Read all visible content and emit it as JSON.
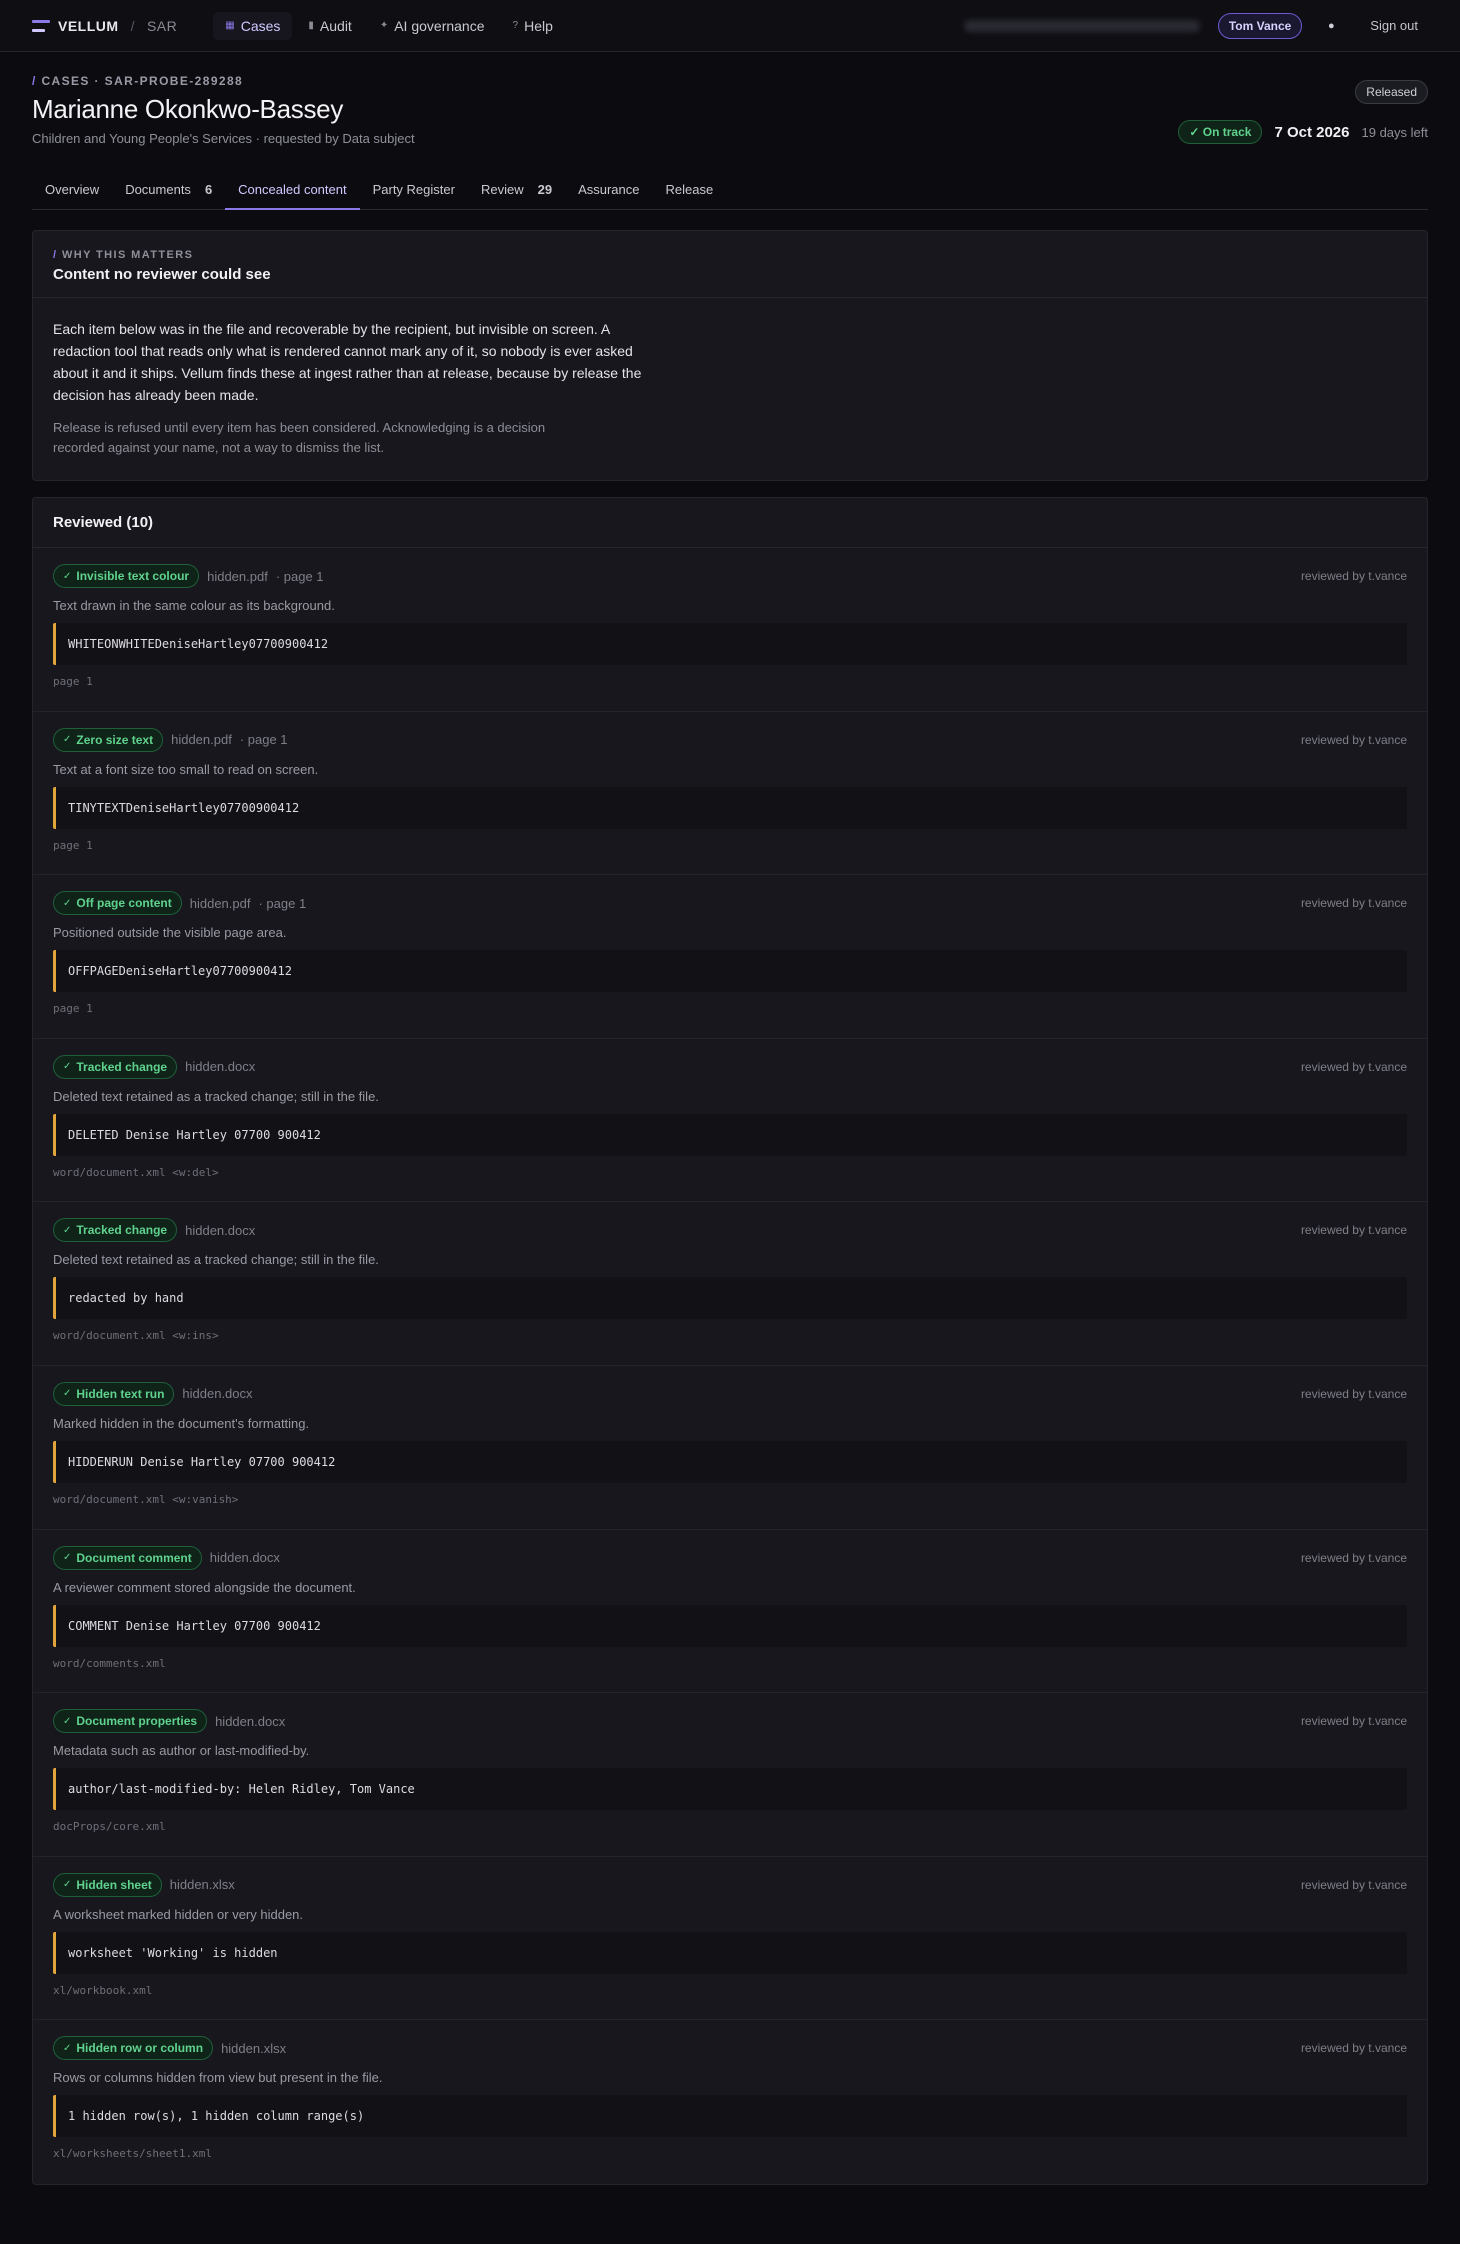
{
  "topbar": {
    "brand": "VELLUM",
    "brand_sub": "SAR",
    "nav": [
      {
        "label": "Cases",
        "icon": "grid-icon",
        "glyph": "▦",
        "active": true
      },
      {
        "label": "Audit",
        "icon": "bars-icon",
        "glyph": "▮",
        "active": false
      },
      {
        "label": "AI governance",
        "icon": "sparkle-icon",
        "glyph": "✦",
        "active": false
      },
      {
        "label": "Help",
        "icon": "question-icon",
        "glyph": "?",
        "active": false
      }
    ],
    "user": "Tom Vance",
    "theme_icon": "●",
    "sign_out": "Sign out"
  },
  "case": {
    "breadcrumb_slash": "/",
    "breadcrumb": "CASES · SAR-PROBE-289288",
    "title": "Marianne Okonkwo-Bassey",
    "subtitle": "Children and Young People's Services · requested by Data subject",
    "status_released": "Released",
    "on_track": "✓ On track",
    "due_date": "7 Oct 2026",
    "days_left": "19 days left"
  },
  "tabs": [
    {
      "label": "Overview",
      "count": ""
    },
    {
      "label": "Documents",
      "count": "6"
    },
    {
      "label": "Concealed content",
      "count": "",
      "active": true
    },
    {
      "label": "Party Register",
      "count": ""
    },
    {
      "label": "Review",
      "count": "29"
    },
    {
      "label": "Assurance",
      "count": ""
    },
    {
      "label": "Release",
      "count": ""
    }
  ],
  "why": {
    "label_slash": "/",
    "label": "WHY THIS MATTERS",
    "title": "Content no reviewer could see",
    "p1": "Each item below was in the file and recoverable by the recipient, but invisible on screen. A redaction tool that reads only what is rendered cannot mark any of it, so nobody is ever asked about it and it ships. Vellum finds these at ingest rather than at release, because by release the decision has already been made.",
    "p2": "Release is refused until every item has been considered. Acknowledging is a decision recorded against your name, not a way to dismiss the list."
  },
  "reviewed": {
    "heading": "Reviewed (10)",
    "check": "✓",
    "reviewer": "reviewed by t.vance",
    "items": [
      {
        "tag": "Invisible text colour",
        "file": "hidden.pdf",
        "page": "· page 1",
        "desc": "Text drawn in the same colour as its background.",
        "snippet": "WHITEONWHITEDeniseHartley07700900412",
        "loc": "page 1"
      },
      {
        "tag": "Zero size text",
        "file": "hidden.pdf",
        "page": "· page 1",
        "desc": "Text at a font size too small to read on screen.",
        "snippet": "TINYTEXTDeniseHartley07700900412",
        "loc": "page 1"
      },
      {
        "tag": "Off page content",
        "file": "hidden.pdf",
        "page": "· page 1",
        "desc": "Positioned outside the visible page area.",
        "snippet": "OFFPAGEDeniseHartley07700900412",
        "loc": "page 1"
      },
      {
        "tag": "Tracked change",
        "file": "hidden.docx",
        "page": "",
        "desc": "Deleted text retained as a tracked change; still in the file.",
        "snippet": "DELETED Denise Hartley 07700 900412",
        "loc": "word/document.xml <w:del>"
      },
      {
        "tag": "Tracked change",
        "file": "hidden.docx",
        "page": "",
        "desc": "Deleted text retained as a tracked change; still in the file.",
        "snippet": "redacted by hand",
        "loc": "word/document.xml <w:ins>"
      },
      {
        "tag": "Hidden text run",
        "file": "hidden.docx",
        "page": "",
        "desc": "Marked hidden in the document's formatting.",
        "snippet": "HIDDENRUN Denise Hartley 07700 900412",
        "loc": "word/document.xml <w:vanish>"
      },
      {
        "tag": "Document comment",
        "file": "hidden.docx",
        "page": "",
        "desc": "A reviewer comment stored alongside the document.",
        "snippet": "COMMENT Denise Hartley 07700 900412",
        "loc": "word/comments.xml"
      },
      {
        "tag": "Document properties",
        "file": "hidden.docx",
        "page": "",
        "desc": "Metadata such as author or last-modified-by.",
        "snippet": "author/last-modified-by: Helen Ridley, Tom Vance",
        "loc": "docProps/core.xml"
      },
      {
        "tag": "Hidden sheet",
        "file": "hidden.xlsx",
        "page": "",
        "desc": "A worksheet marked hidden or very hidden.",
        "snippet": "worksheet 'Working' is hidden",
        "loc": "xl/workbook.xml"
      },
      {
        "tag": "Hidden row or column",
        "file": "hidden.xlsx",
        "page": "",
        "desc": "Rows or columns hidden from view but present in the file.",
        "snippet": "1 hidden row(s), 1 hidden column range(s)",
        "loc": "xl/worksheets/sheet1.xml"
      }
    ]
  }
}
